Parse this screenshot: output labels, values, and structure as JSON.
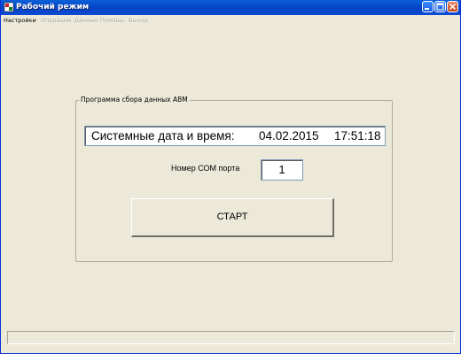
{
  "window": {
    "title": "Рабочий режим"
  },
  "menu": {
    "items": [
      {
        "label": "Настройки",
        "enabled": true
      },
      {
        "label": "Операции",
        "enabled": false
      },
      {
        "label": "Данные",
        "enabled": false
      },
      {
        "label": "Помощь",
        "enabled": false
      },
      {
        "label": "Выход",
        "enabled": false
      }
    ]
  },
  "group": {
    "title": "Программа сбора данных АВМ"
  },
  "datetime": {
    "label": "Системные дата и время:",
    "date": "04.02.2015",
    "time": "17:51:18"
  },
  "com_port": {
    "label": "Номер СОМ порта",
    "value": "1"
  },
  "start_button": {
    "label": "СТАРТ"
  },
  "icons": {
    "app": "app-icon",
    "minimize": "minimize-icon",
    "maximize": "maximize-icon",
    "close": "close-icon"
  },
  "colors": {
    "titlebar": "#0543c4",
    "window_bg": "#ece9d8",
    "close_button": "#c74618"
  }
}
